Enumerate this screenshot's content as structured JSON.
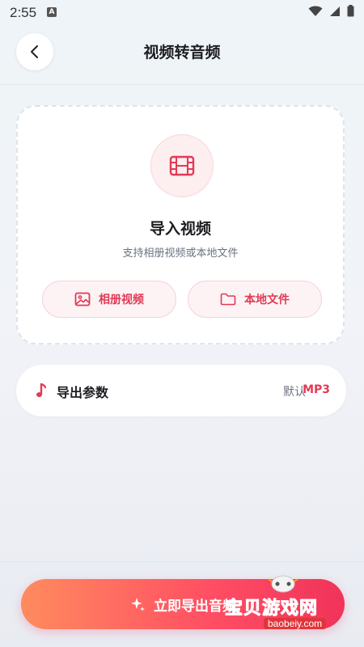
{
  "status": {
    "time": "2:55"
  },
  "header": {
    "title": "视频转音频"
  },
  "import": {
    "title": "导入视频",
    "subtitle": "支持相册视频或本地文件",
    "album_label": "相册视频",
    "local_label": "本地文件"
  },
  "params": {
    "label": "导出参数",
    "default_label": "默认",
    "format": "MP3"
  },
  "export": {
    "label": "立即导出音频"
  },
  "watermark": {
    "text": "宝贝游戏网",
    "url": "baobeiy.com"
  },
  "colors": {
    "accent": "#e23a55",
    "gradient_start": "#ff8b5e",
    "gradient_end": "#f0335a"
  }
}
